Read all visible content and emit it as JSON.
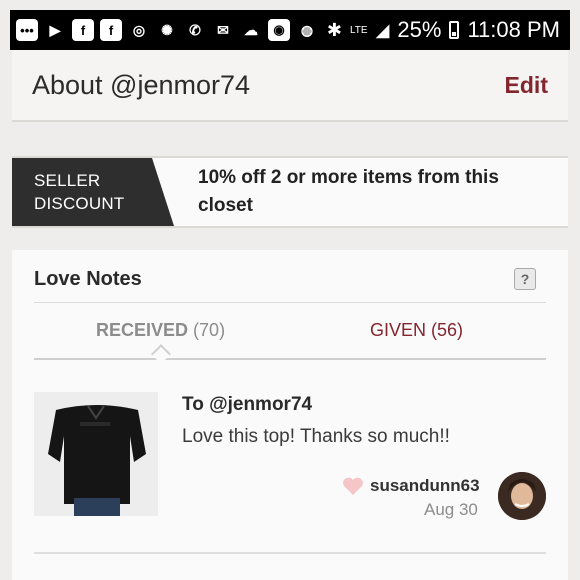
{
  "status_bar": {
    "battery": "25%",
    "time": "11:08 PM",
    "network": "LTE"
  },
  "about": {
    "title": "About @jenmor74",
    "edit_label": "Edit"
  },
  "discount": {
    "tag_line1": "SELLER",
    "tag_line2": "DISCOUNT",
    "text": "10% off 2 or more items from this closet"
  },
  "love_notes": {
    "title": "Love Notes",
    "help": "?",
    "tabs": {
      "received_label": "RECEIVED",
      "received_count": "(70)",
      "given_label": "GIVEN",
      "given_count": "(56)"
    },
    "note": {
      "to": "To @jenmor74",
      "message": "Love this top! Thanks so much!!",
      "user": "susandunn63",
      "date": "Aug 30"
    }
  },
  "colors": {
    "accent": "#82252f",
    "tag_bg": "#2e2e2e",
    "heart": "#f4c6c8"
  }
}
